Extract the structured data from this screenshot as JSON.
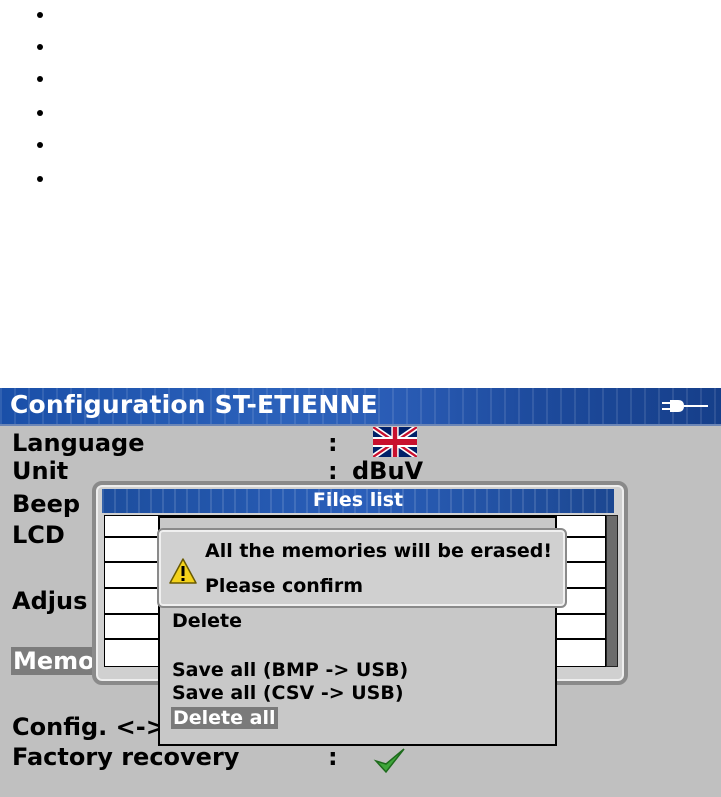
{
  "bullets_count": 6,
  "window": {
    "title": "Configuration ST-ETIENNE"
  },
  "icons": {
    "power": "power-plug-icon",
    "language": "uk-flag-icon",
    "factory": "checkmark-icon",
    "warning": "warning-icon"
  },
  "settings": {
    "language_label": "Language",
    "unit_label": "Unit",
    "unit_value": "dBuV",
    "beep_label": "Beep",
    "lcd_label": "LCD",
    "adjust_label": "Adjus",
    "memo_label": "Memo",
    "config_label": "Config. <->",
    "factory_label": "Factory recovery",
    "colon": ":"
  },
  "files_dialog": {
    "title": "Files list"
  },
  "menu": {
    "delete": "Delete",
    "save_bmp": "Save all (BMP -> USB)",
    "save_csv": "Save all (CSV -> USB)",
    "delete_all": "Delete all"
  },
  "confirm": {
    "message": "All the memories will be erased!",
    "prompt": "Please confirm"
  }
}
